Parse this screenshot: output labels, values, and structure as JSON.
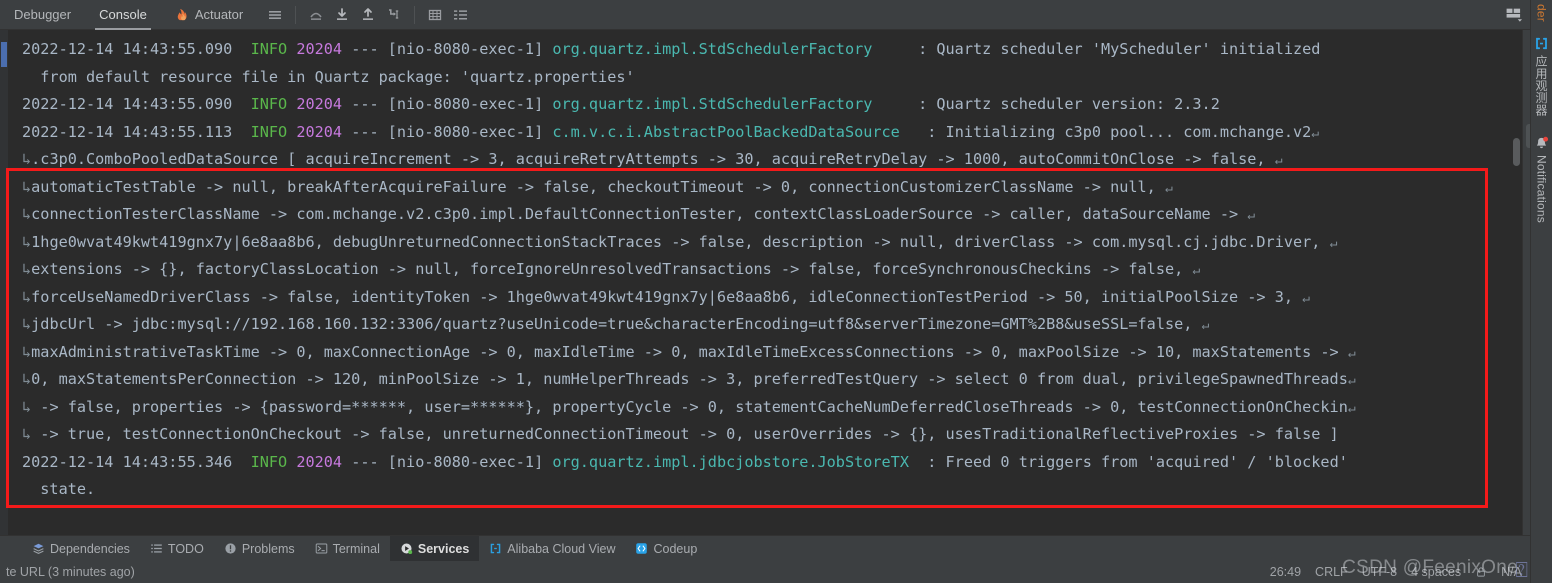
{
  "window": {
    "background": "#3c3f41",
    "console_background": "#2b2b2b",
    "highlight_color": "#f41a1a"
  },
  "toolbar": {
    "tabs": [
      {
        "label": "Debugger",
        "icon": "",
        "active": false
      },
      {
        "label": "Console",
        "icon": "",
        "active": true
      },
      {
        "label": "Actuator",
        "icon": "actuator-flame-icon",
        "active": false
      }
    ],
    "icons": [
      "layout-lines-icon",
      "step-over-icon",
      "step-into-icon",
      "step-out-icon",
      "run-to-cursor-icon",
      "evaluate-grid-icon",
      "soft-wrap-icon"
    ]
  },
  "right_toolbar": {
    "icons": [
      "scroll-up-icon",
      "scroll-down-icon",
      "soft-wrap-toggle-icon",
      "scroll-to-end-icon",
      "print-icon",
      "trash-icon"
    ],
    "top_icon": "window-layout-icon"
  },
  "right_stripe": {
    "items": [
      {
        "label": "der",
        "color": "orange",
        "icon": ""
      },
      {
        "label": "应用观测器",
        "color": "normal",
        "icon": "endpoints-icon"
      },
      {
        "label": "Notifications",
        "color": "normal",
        "icon": "bell-icon"
      }
    ]
  },
  "console": {
    "lines": [
      {
        "type": "log",
        "date": "2022-12-14 14:43:55.090",
        "level": "INFO",
        "pid": "20204",
        "sep": "---",
        "thread": "[nio-8080-exec-1]",
        "logger": "org.quartz.impl.StdSchedulerFactory",
        "pad": "     ",
        "message": ": Quartz scheduler 'MyScheduler' initialized",
        "wrap": false
      },
      {
        "type": "plain",
        "text": "  from default resource file in Quartz package: 'quartz.properties'"
      },
      {
        "type": "log",
        "date": "2022-12-14 14:43:55.090",
        "level": "INFO",
        "pid": "20204",
        "sep": "---",
        "thread": "[nio-8080-exec-1]",
        "logger": "org.quartz.impl.StdSchedulerFactory",
        "pad": "     ",
        "message": ": Quartz scheduler version: 2.3.2",
        "wrap": false
      },
      {
        "type": "log",
        "date": "2022-12-14 14:43:55.113",
        "level": "INFO",
        "pid": "20204",
        "sep": "---",
        "thread": "[nio-8080-exec-1]",
        "logger": "c.m.v.c.i.AbstractPoolBackedDataSource",
        "pad": "   ",
        "message": ": Initializing c3p0 pool... com.mchange.v2",
        "wrap": true,
        "highlighted": true
      },
      {
        "type": "cont",
        "text": ".c3p0.ComboPooledDataSource [ acquireIncrement -> 3, acquireRetryAttempts -> 30, acquireRetryDelay -> 1000, autoCommitOnClose -> false, ",
        "wrap": true,
        "highlighted": true
      },
      {
        "type": "cont",
        "text": "automaticTestTable -> null, breakAfterAcquireFailure -> false, checkoutTimeout -> 0, connectionCustomizerClassName -> null, ",
        "wrap": true,
        "highlighted": true
      },
      {
        "type": "cont",
        "text": "connectionTesterClassName -> com.mchange.v2.c3p0.impl.DefaultConnectionTester, contextClassLoaderSource -> caller, dataSourceName -> ",
        "wrap": true,
        "highlighted": true
      },
      {
        "type": "cont",
        "text": "1hge0wvat49kwt419gnx7y|6e8aa8b6, debugUnreturnedConnectionStackTraces -> false, description -> null, driverClass -> com.mysql.cj.jdbc.Driver, ",
        "wrap": true,
        "highlighted": true
      },
      {
        "type": "cont",
        "text": "extensions -> {}, factoryClassLocation -> null, forceIgnoreUnresolvedTransactions -> false, forceSynchronousCheckins -> false, ",
        "wrap": true,
        "highlighted": true
      },
      {
        "type": "cont",
        "text": "forceUseNamedDriverClass -> false, identityToken -> 1hge0wvat49kwt419gnx7y|6e8aa8b6, idleConnectionTestPeriod -> 50, initialPoolSize -> 3, ",
        "wrap": true,
        "highlighted": true
      },
      {
        "type": "cont",
        "text": "jdbcUrl -> jdbc:mysql://192.168.160.132:3306/quartz?useUnicode=true&characterEncoding=utf8&serverTimezone=GMT%2B8&useSSL=false, ",
        "wrap": true,
        "highlighted": true
      },
      {
        "type": "cont",
        "text": "maxAdministrativeTaskTime -> 0, maxConnectionAge -> 0, maxIdleTime -> 0, maxIdleTimeExcessConnections -> 0, maxPoolSize -> 10, maxStatements -> ",
        "wrap": true,
        "highlighted": true
      },
      {
        "type": "cont",
        "text": "0, maxStatementsPerConnection -> 120, minPoolSize -> 1, numHelperThreads -> 3, preferredTestQuery -> select 0 from dual, privilegeSpawnedThreads",
        "wrap": true,
        "highlighted": true
      },
      {
        "type": "cont",
        "text": " -> false, properties -> {password=******, user=******}, propertyCycle -> 0, statementCacheNumDeferredCloseThreads -> 0, testConnectionOnCheckin",
        "wrap": true,
        "highlighted": true
      },
      {
        "type": "cont",
        "text": " -> true, testConnectionOnCheckout -> false, unreturnedConnectionTimeout -> 0, userOverrides -> {}, usesTraditionalReflectiveProxies -> false ]",
        "wrap": false,
        "highlighted": true
      },
      {
        "type": "log",
        "date": "2022-12-14 14:43:55.346",
        "level": "INFO",
        "pid": "20204",
        "sep": "---",
        "thread": "[nio-8080-exec-1]",
        "logger": "org.quartz.impl.jdbcjobstore.JobStoreTX",
        "pad": "  ",
        "message": ": Freed 0 triggers from 'acquired' / 'blocked'",
        "wrap": false
      },
      {
        "type": "plain",
        "text": "  state."
      }
    ],
    "wrap_glyph": "↵",
    "cont_glyph": "↳"
  },
  "bottom_bar": {
    "items": [
      {
        "label": "Dependencies",
        "icon": "dependencies-icon",
        "active": false
      },
      {
        "label": "TODO",
        "icon": "todo-list-icon",
        "active": false
      },
      {
        "label": "Problems",
        "icon": "problems-warning-icon",
        "active": false
      },
      {
        "label": "Terminal",
        "icon": "terminal-icon",
        "active": false
      },
      {
        "label": "Services",
        "icon": "services-play-icon",
        "active": true
      },
      {
        "label": "Alibaba Cloud View",
        "icon": "alibaba-cloud-icon",
        "active": false
      },
      {
        "label": "Codeup",
        "icon": "codeup-icon",
        "active": false
      }
    ]
  },
  "status_bar": {
    "message": "te URL (3 minutes ago)",
    "caret": "26:49",
    "line_separator": "CRLF",
    "encoding": "UTF-8",
    "indent": "4 spaces",
    "branch": "N/A"
  },
  "watermark": {
    "text": "CSDN @FeenixOne"
  }
}
